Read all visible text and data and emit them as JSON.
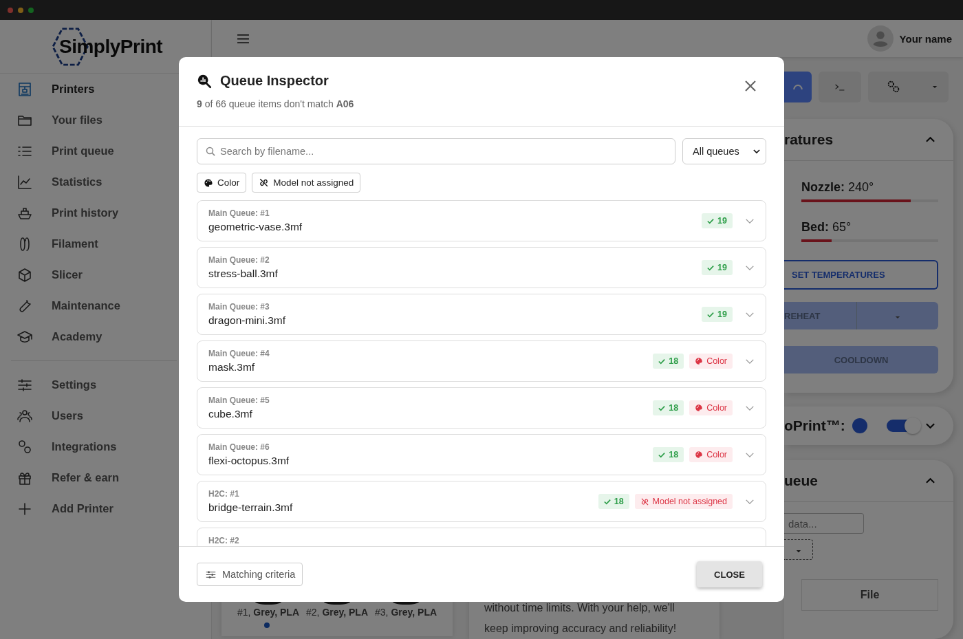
{
  "sidebar": {
    "logo": "SimplyPrint",
    "groups": [
      [
        {
          "label": "Printers",
          "selected": true
        },
        {
          "label": "Your files",
          "selected": false
        },
        {
          "label": "Print queue",
          "selected": false
        },
        {
          "label": "Statistics",
          "selected": false
        },
        {
          "label": "Print history",
          "selected": false
        },
        {
          "label": "Filament",
          "selected": false
        },
        {
          "label": "Slicer",
          "selected": false
        },
        {
          "label": "Maintenance",
          "selected": false
        },
        {
          "label": "Academy",
          "selected": false
        }
      ],
      [
        {
          "label": "Settings",
          "selected": false
        },
        {
          "label": "Users",
          "selected": false
        },
        {
          "label": "Integrations",
          "selected": false
        },
        {
          "label": "Refer & earn",
          "selected": false
        },
        {
          "label": "Add Printer",
          "selected": false
        }
      ]
    ]
  },
  "topbar": {
    "user": "Your name"
  },
  "temperatures": {
    "title": "ratures",
    "heaters": [
      {
        "label": "Nozzle:",
        "value": "240°",
        "level": 0.8
      },
      {
        "label": "Bed:",
        "value": "65°",
        "level": 0.22
      }
    ],
    "set_button": "SET TEMPERATURES",
    "preheat_button": "REHEAT",
    "cooldown_button": "COOLDOWN"
  },
  "autoprint": {
    "title": "oPrint™:",
    "on": true
  },
  "queue_card": {
    "title": "ueue",
    "search_placeholder": "data...",
    "column": "File"
  },
  "filament_spools": [
    "#1, **Grey, PLA**",
    "#2, **Grey, PLA**",
    "#3, **Grey, PLA**"
  ],
  "notice_text": [
    "without time limits. With your help, we'll",
    "keep improving accuracy and reliability!"
  ],
  "modal": {
    "title": "Queue Inspector",
    "subtitle": "**9** of 66 queue items don't match **A06**",
    "search_placeholder": "Search by filename...",
    "queue_select": "All queues",
    "filters": [
      {
        "kind": "color",
        "label": "Color"
      },
      {
        "kind": "model",
        "label": "Model not assigned"
      }
    ],
    "items": [
      {
        "queue": "Main Queue: #1",
        "file": "geometric-vase.3mf",
        "count": "19"
      },
      {
        "queue": "Main Queue: #2",
        "file": "stress-ball.3mf",
        "count": "19"
      },
      {
        "queue": "Main Queue: #3",
        "file": "dragon-mini.3mf",
        "count": "19"
      },
      {
        "queue": "Main Queue: #4",
        "file": "mask.3mf",
        "count": "18",
        "issues": [
          {
            "kind": "color",
            "label": "Color"
          }
        ]
      },
      {
        "queue": "Main Queue: #5",
        "file": "cube.3mf",
        "count": "18",
        "issues": [
          {
            "kind": "color",
            "label": "Color"
          }
        ]
      },
      {
        "queue": "Main Queue: #6",
        "file": "flexi-octopus.3mf",
        "count": "18",
        "issues": [
          {
            "kind": "color",
            "label": "Color"
          }
        ]
      },
      {
        "queue": "H2C: #1",
        "file": "bridge-terrain.3mf",
        "count": "18",
        "issues": [
          {
            "kind": "model",
            "label": "Model not assigned"
          }
        ]
      },
      {
        "queue": "H2C: #2"
      }
    ],
    "criteria_button": "Matching criteria",
    "close_button": "CLOSE"
  }
}
